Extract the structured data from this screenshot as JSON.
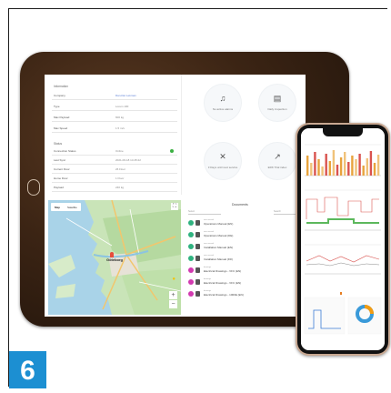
{
  "tablet": {
    "information": {
      "title": "Information",
      "rows": [
        {
          "key": "Company",
          "value": "Dan-Det Lekman",
          "link": true
        },
        {
          "key": "Type",
          "value": "Lorem 100",
          "link": false
        },
        {
          "key": "Max Payload",
          "value": "600 kg",
          "link": false
        },
        {
          "key": "Max Speed",
          "value": "1.5 m/s",
          "link": false
        }
      ]
    },
    "status": {
      "title": "Status",
      "rows": [
        {
          "key": "Connection Status",
          "value": "Online"
        },
        {
          "key": "Last Sync",
          "value": "2021-06-18 14:45:22"
        },
        {
          "key": "Current Floor",
          "value": "26 Floor"
        },
        {
          "key": "Home Floor",
          "value": "1 Floor"
        },
        {
          "key": "Payload",
          "value": "240 kg"
        }
      ]
    },
    "tiles": [
      {
        "icon": "bell-icon",
        "glyph": "🔔",
        "label": "No active alarms"
      },
      {
        "icon": "clipboard-icon",
        "glyph": "📋",
        "label": "Daily inspection"
      },
      {
        "icon": "tools-icon",
        "glyph": "✖",
        "label": "3 Days until next service"
      },
      {
        "icon": "chart-icon",
        "glyph": "📈",
        "label": "ERK Trial index"
      }
    ],
    "map": {
      "tab_map": "Map",
      "tab_satellite": "Satellite",
      "city": "Göteborg",
      "zoom_in": "+",
      "zoom_out": "−"
    },
    "documents": {
      "title": "Documents",
      "filter_placeholder": "Select",
      "search_placeholder": "Search",
      "items": [
        {
          "small": "user manual",
          "title": "Operations Manual (EN)",
          "color": "#2fb380"
        },
        {
          "small": "user manual",
          "title": "Operations Manual (DE)",
          "color": "#2fb380"
        },
        {
          "small": "user manual",
          "title": "Installation Manual (EN)",
          "color": "#2fb380"
        },
        {
          "small": "user manual",
          "title": "Installation Manual (FR)",
          "color": "#2fb380"
        },
        {
          "small": "drawings",
          "title": "Electrical Drawings - VFC (EN)",
          "color": "#d23ab0"
        },
        {
          "small": "drawings",
          "title": "Electrical Drawings - VFC (EN)",
          "color": "#d23ab0"
        },
        {
          "small": "drawings",
          "title": "Electrical Drawings - 1000E (EN)",
          "color": "#d23ab0"
        }
      ]
    }
  },
  "badge": {
    "number": "6"
  }
}
